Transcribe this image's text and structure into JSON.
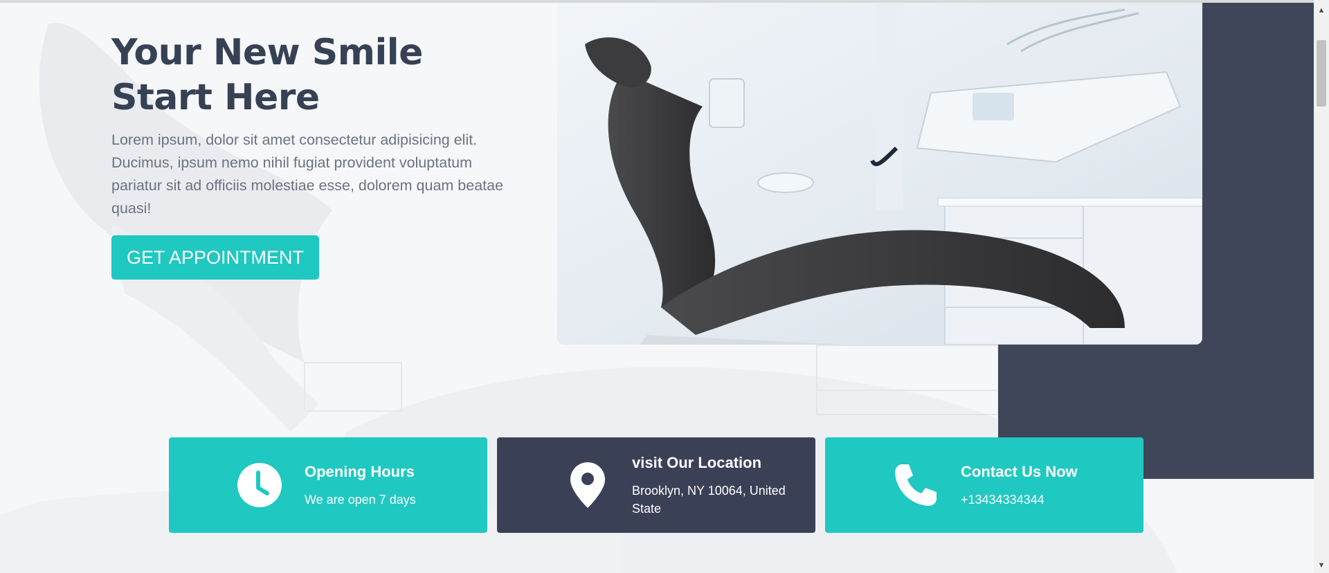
{
  "hero": {
    "title_line1": "Your New Smile",
    "title_line2": "Start Here",
    "text": "Lorem ipsum, dolor sit amet consectetur adipisicing elit. Ducimus, ipsum nemo nihil fugiat provident voluptatum pariatur sit ad officiis molestiae esse, dolorem quam beatae quasi!",
    "cta_label": "GET APPOINTMENT"
  },
  "cards": [
    {
      "icon": "clock-icon",
      "title": "Opening Hours",
      "text": "We are open 7 days"
    },
    {
      "icon": "location-pin-icon",
      "title": "visit Our Location",
      "text": "Brooklyn, NY 10064, United State"
    },
    {
      "icon": "phone-icon",
      "title": "Contact Us Now",
      "text": "+13434334344"
    }
  ],
  "colors": {
    "accent": "#1fc8c0",
    "dark": "#3a4056",
    "heading": "#364154",
    "body_text": "#6b7280"
  },
  "scrollbar": {
    "up_icon": "scroll-up-arrow-icon",
    "down_icon": "scroll-down-arrow-icon"
  }
}
